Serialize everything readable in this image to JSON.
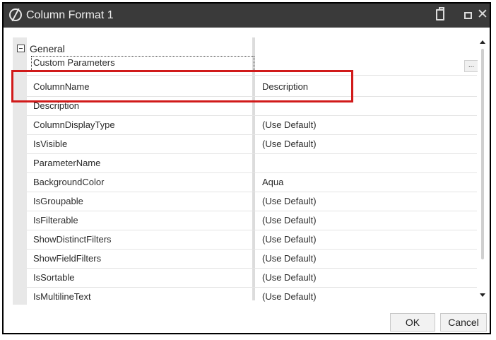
{
  "window": {
    "title": "Column Format 1"
  },
  "grid": {
    "group_label": "General",
    "rows": [
      {
        "name": "Custom Parameters",
        "value": ""
      },
      {
        "name": "ColumnName",
        "value": "Description"
      },
      {
        "name": "Description",
        "value": ""
      },
      {
        "name": "ColumnDisplayType",
        "value": "(Use Default)"
      },
      {
        "name": "IsVisible",
        "value": "(Use Default)"
      },
      {
        "name": "ParameterName",
        "value": ""
      },
      {
        "name": "BackgroundColor",
        "value": "Aqua"
      },
      {
        "name": "IsGroupable",
        "value": "(Use Default)"
      },
      {
        "name": "IsFilterable",
        "value": "(Use Default)"
      },
      {
        "name": "ShowDistinctFilters",
        "value": "(Use Default)"
      },
      {
        "name": "ShowFieldFilters",
        "value": "(Use Default)"
      },
      {
        "name": "IsSortable",
        "value": "(Use Default)"
      },
      {
        "name": "IsMultilineText",
        "value": "(Use Default)"
      }
    ],
    "ellipsis_label": "..."
  },
  "buttons": {
    "ok": "OK",
    "cancel": "Cancel"
  },
  "icons": {
    "app": "app-logo-icon",
    "clipboard": "clipboard-icon",
    "maximize": "maximize-icon",
    "close": "close-icon",
    "collapse": "collapse-minus-icon"
  },
  "colors": {
    "titlebar": "#3a3a3a",
    "highlight": "#d11a1a"
  }
}
